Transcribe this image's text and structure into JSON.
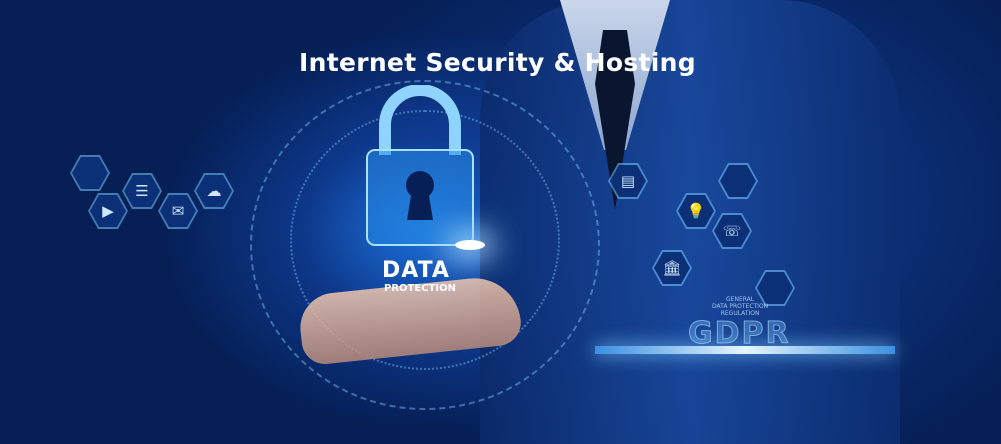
{
  "banner": {
    "title": "Internet Security & Hosting",
    "lock_label": "DATA",
    "lock_sublabel": "PROTECTION",
    "gdpr_caption": [
      "GENERAL",
      "DATA PROTECTION",
      "REGULATION"
    ],
    "gdpr_label": "GDPR"
  },
  "icons": {
    "left": [
      "video-icon",
      "server-icon",
      "mail-icon",
      "cloud-icon"
    ],
    "right": [
      "document-icon",
      "lightbulb-icon",
      "phone-icon",
      "bank-icon"
    ]
  },
  "colors": {
    "background": "#061f55",
    "accent": "#4fb3ff"
  }
}
